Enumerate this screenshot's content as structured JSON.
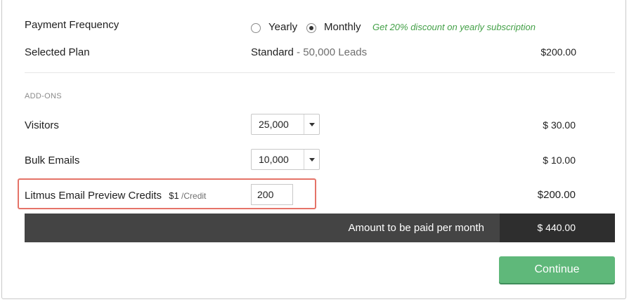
{
  "payment": {
    "label": "Payment Frequency",
    "options": [
      {
        "label": "Yearly",
        "checked": false
      },
      {
        "label": "Monthly",
        "checked": true
      }
    ],
    "discount_note": "Get 20% discount on yearly subscription"
  },
  "selected_plan": {
    "label": "Selected Plan",
    "plan_name": "Standard",
    "plan_detail": " - 50,000 Leads",
    "price": "$200.00"
  },
  "addons": {
    "heading": "ADD-ONS",
    "visitors": {
      "label": "Visitors",
      "value": "25,000",
      "price": "$  30.00"
    },
    "bulk_emails": {
      "label": "Bulk Emails",
      "value": "10,000",
      "price": "$  10.00"
    },
    "litmus": {
      "label": "Litmus Email Preview Credits",
      "rate": "$1",
      "rate_unit": " /Credit",
      "value": "200",
      "price": "$200.00"
    }
  },
  "total": {
    "label": "Amount to be paid per month",
    "price": "$ 440.00"
  },
  "actions": {
    "continue_label": "Continue"
  }
}
